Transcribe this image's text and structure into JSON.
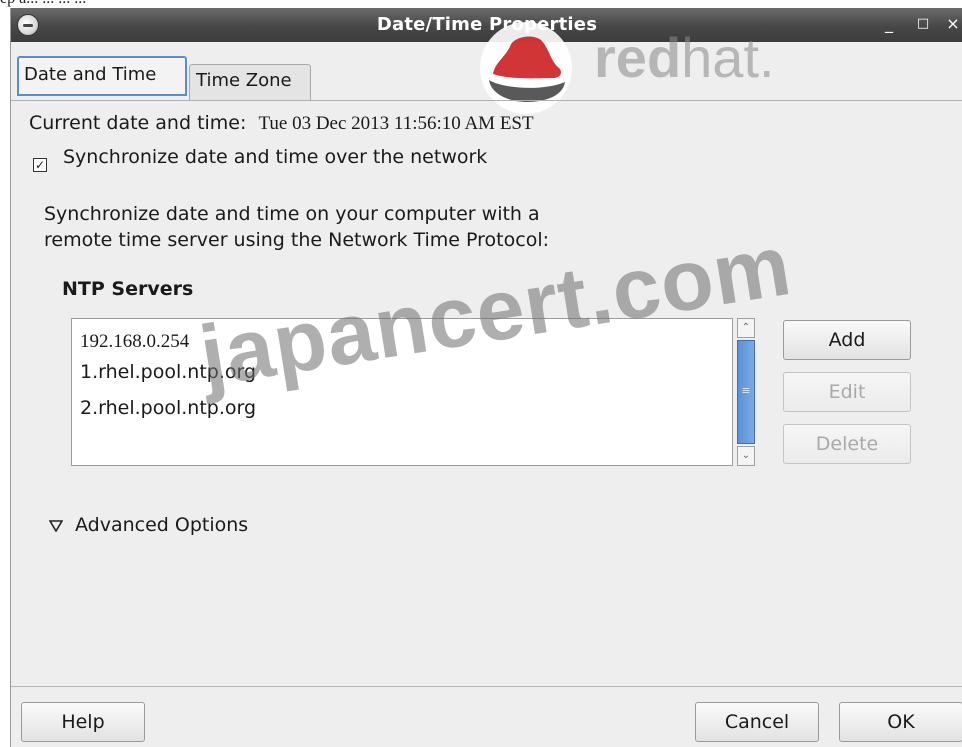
{
  "top_caption": "ep a...   ...    ...    ...",
  "window": {
    "title": "Date/Time Properties",
    "minimize_glyph": "_",
    "maximize_glyph": "□",
    "close_glyph": "×"
  },
  "watermarks": {
    "redhat_bold": "red",
    "redhat_light": "hat.",
    "japancert": "japancert.com"
  },
  "tabs": [
    {
      "label": "Date and Time",
      "active": true
    },
    {
      "label": "Time Zone",
      "active": false
    }
  ],
  "current": {
    "label": "Current date and time:",
    "value": "Tue 03 Dec 2013 11:56:10 AM EST"
  },
  "sync": {
    "checked": true,
    "label": "Synchronize date and time over the network"
  },
  "description": {
    "line1": "Synchronize date and time on your computer with a",
    "line2": "remote time server using the Network Time Protocol:"
  },
  "ntp": {
    "heading": "NTP Servers",
    "servers": [
      "192.168.0.254",
      "1.rhel.pool.ntp.org",
      "2.rhel.pool.ntp.org"
    ],
    "buttons": {
      "add": "Add",
      "edit": "Edit",
      "delete": "Delete"
    }
  },
  "advanced": {
    "label": "Advanced Options"
  },
  "footer": {
    "help": "Help",
    "cancel": "Cancel",
    "ok": "OK"
  }
}
